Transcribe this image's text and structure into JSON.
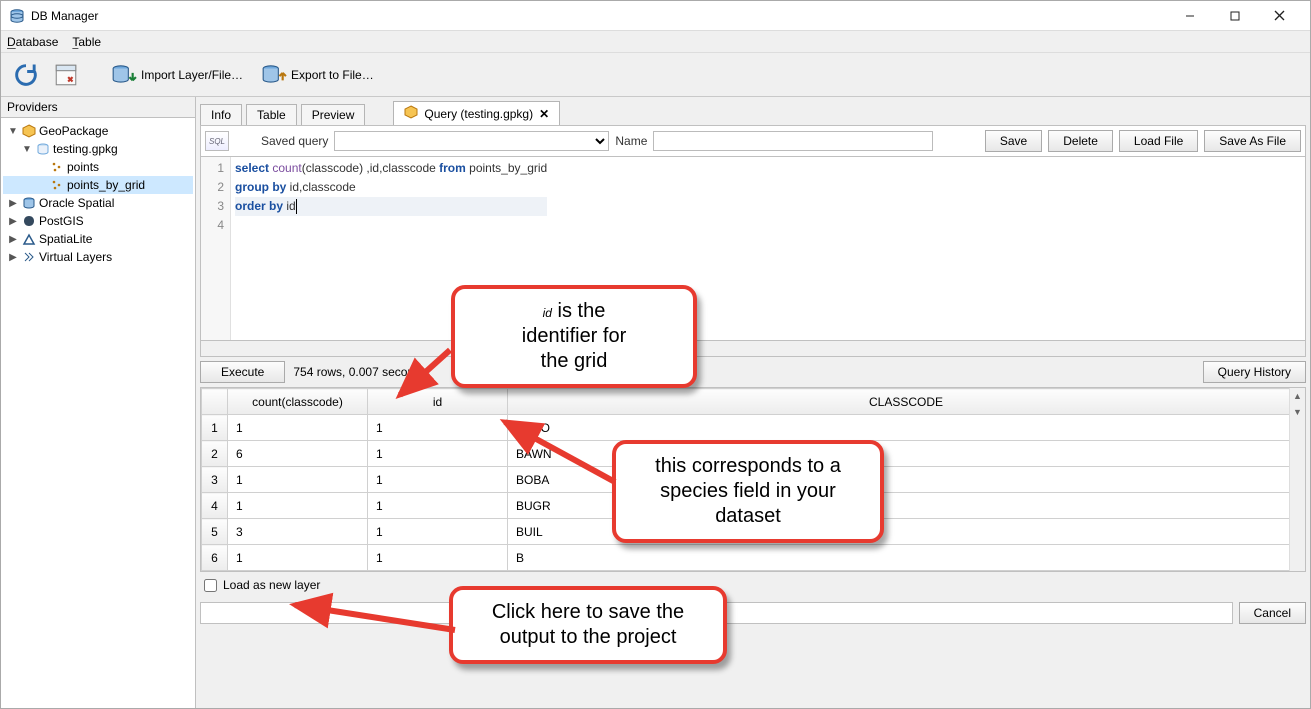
{
  "window": {
    "title": "DB Manager"
  },
  "menu": {
    "database": "Database",
    "table": "Table"
  },
  "toolbar": {
    "import": "Import Layer/File…",
    "export": "Export to File…"
  },
  "providers": {
    "heading": "Providers",
    "items": {
      "gpkg": "GeoPackage",
      "testing": "testing.gpkg",
      "points": "points",
      "points_by_grid": "points_by_grid",
      "oracle": "Oracle Spatial",
      "postgis": "PostGIS",
      "spatialite": "SpatiaLite",
      "virtual": "Virtual Layers"
    }
  },
  "tabs": {
    "info": "Info",
    "table": "Table",
    "preview": "Preview",
    "query": "Query (testing.gpkg)"
  },
  "queryBar": {
    "savedLabel": "Saved query",
    "nameLabel": "Name",
    "nameValue": "",
    "save": "Save",
    "delete": "Delete",
    "load": "Load File",
    "saveas": "Save As File"
  },
  "sql": {
    "l1a": "select",
    "l1b": "count",
    "l1c": "(classcode) ,id,classcode",
    "l1d": "from",
    "l1e": "points_by_grid",
    "l2a": "group by",
    "l2b": "id,classcode",
    "l3a": "order by",
    "l3b": "id",
    "n1": "1",
    "n2": "2",
    "n3": "3",
    "n4": "4"
  },
  "exec": {
    "button": "Execute",
    "status": "754 rows, 0.007 seconds",
    "history": "Query History"
  },
  "chart_data": {
    "type": "table",
    "columns": [
      "count(classcode)",
      "id",
      "CLASSCODE"
    ],
    "rows": [
      {
        "n": "1",
        "count": "1",
        "id": "1",
        "code": "BARO"
      },
      {
        "n": "2",
        "count": "6",
        "id": "1",
        "code": "BAWN"
      },
      {
        "n": "3",
        "count": "1",
        "id": "1",
        "code": "BOBA"
      },
      {
        "n": "4",
        "count": "1",
        "id": "1",
        "code": "BUGR"
      },
      {
        "n": "5",
        "count": "3",
        "id": "1",
        "code": "BUIL"
      },
      {
        "n": "6",
        "count": "1",
        "id": "1",
        "code": "B"
      }
    ]
  },
  "footer": {
    "loadAsLayer": "Load as new layer",
    "cancel": "Cancel"
  },
  "callouts": {
    "c1": "id is the identifier for the grid",
    "c2": "this corresponds to a species field in your dataset",
    "c3": "Click here to save the output to the project"
  }
}
